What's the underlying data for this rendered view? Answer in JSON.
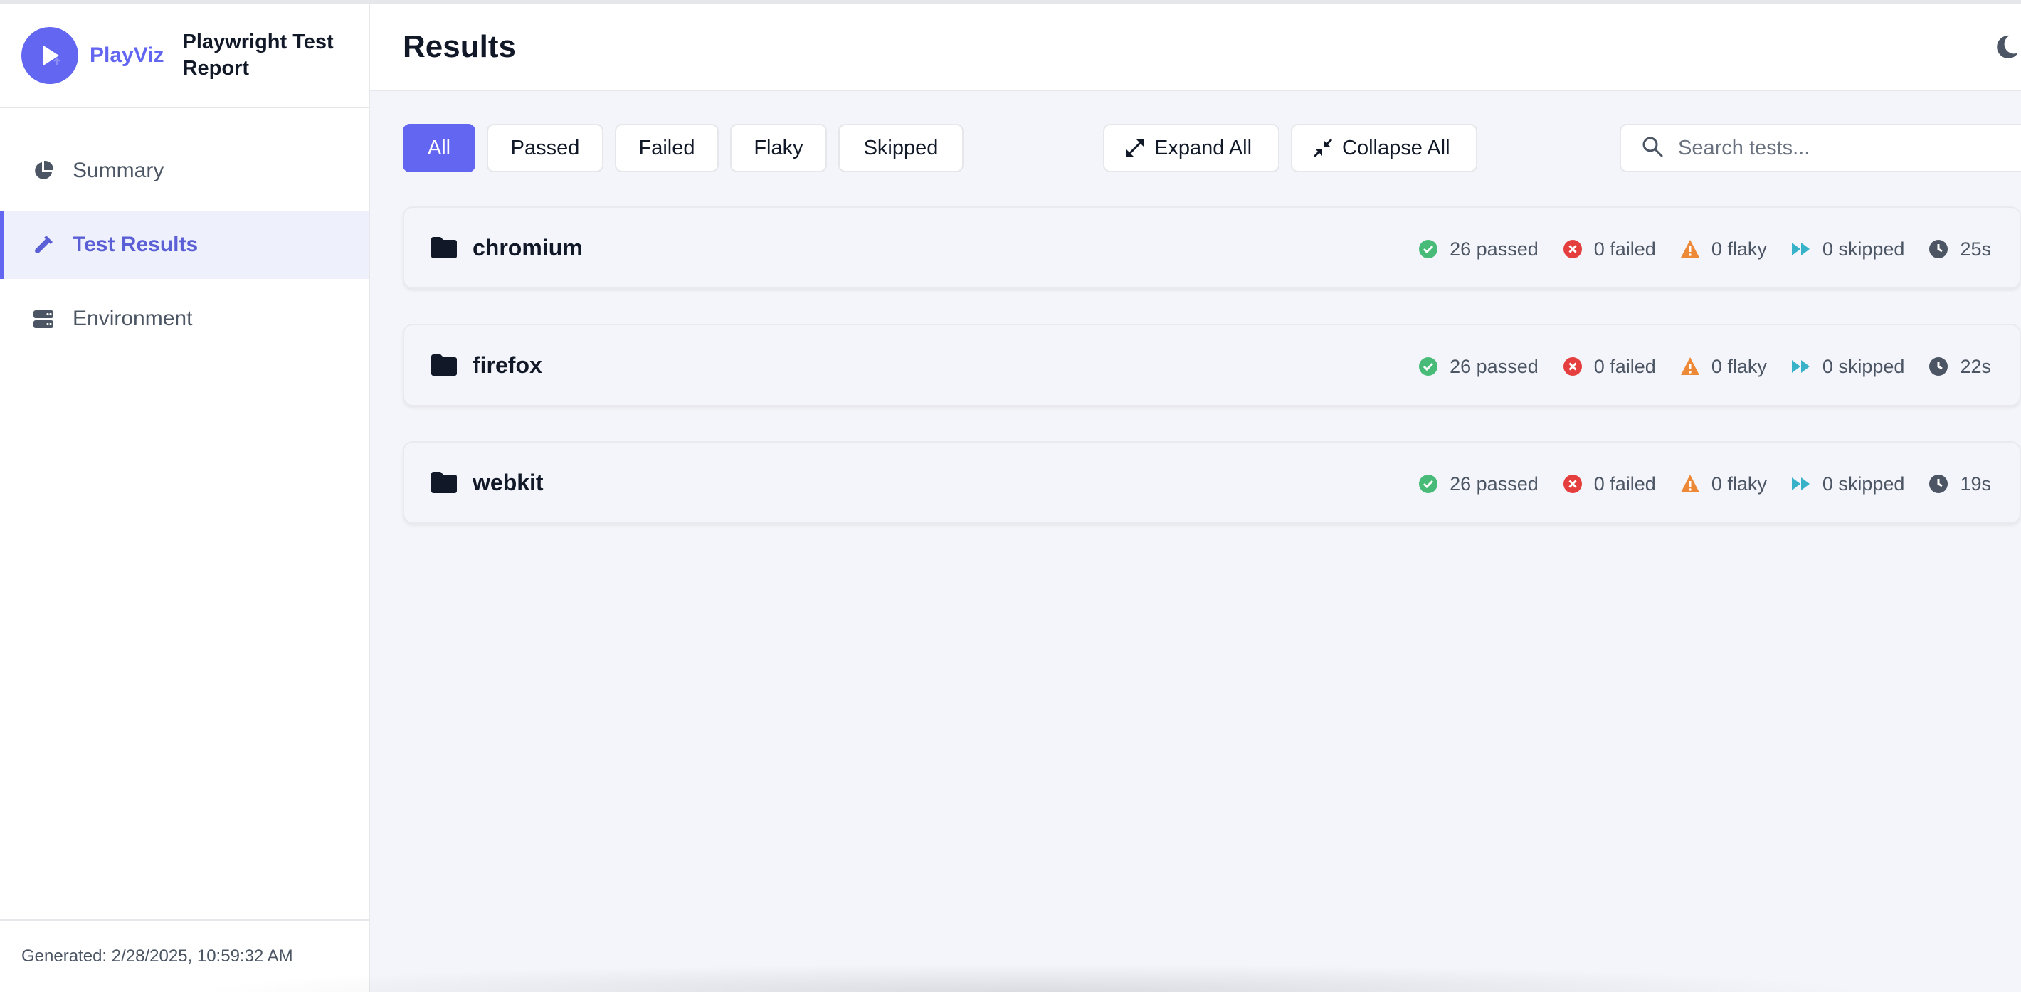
{
  "brand": {
    "logo_text": "PlayViz",
    "title": "Playwright Test Report",
    "accent": "#6366f1"
  },
  "sidebar": {
    "items": [
      {
        "label": "Summary",
        "icon": "pie-chart-icon",
        "active": false
      },
      {
        "label": "Test Results",
        "icon": "flask-icon",
        "active": true
      },
      {
        "label": "Environment",
        "icon": "server-icon",
        "active": false
      }
    ],
    "footer": "Generated: 2/28/2025, 10:59:32 AM"
  },
  "header": {
    "title": "Results",
    "theme_icon": "moon-icon"
  },
  "filters": {
    "items": [
      "All",
      "Passed",
      "Failed",
      "Flaky",
      "Skipped"
    ],
    "selected": "All"
  },
  "actions": {
    "expand_label": "Expand All",
    "collapse_label": "Collapse All"
  },
  "search": {
    "placeholder": "Search tests...",
    "value": ""
  },
  "groups": [
    {
      "name": "chromium",
      "passed": "26 passed",
      "failed": "0 failed",
      "flaky": "0 flaky",
      "skipped": "0 skipped",
      "duration": "25s"
    },
    {
      "name": "firefox",
      "passed": "26 passed",
      "failed": "0 failed",
      "flaky": "0 flaky",
      "skipped": "0 skipped",
      "duration": "22s"
    },
    {
      "name": "webkit",
      "passed": "26 passed",
      "failed": "0 failed",
      "flaky": "0 flaky",
      "skipped": "0 skipped",
      "duration": "19s"
    }
  ],
  "colors": {
    "passed": "#48bb78",
    "failed": "#e53e3e",
    "flaky": "#ed8936",
    "skipped": "#38b2c8",
    "duration": "#4b5563"
  }
}
